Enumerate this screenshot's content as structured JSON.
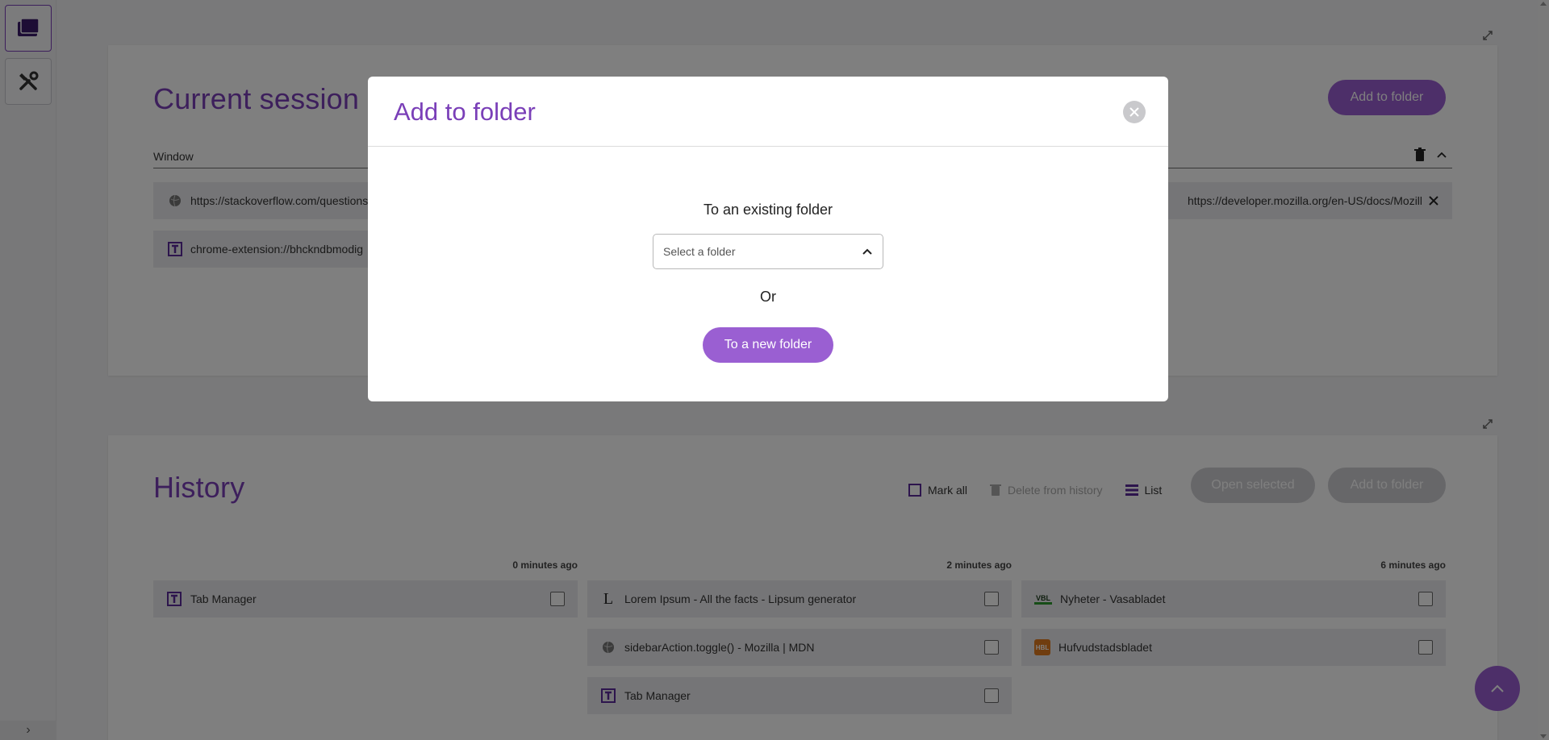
{
  "sidebar": {
    "items": [
      {
        "icon": "folders-icon"
      },
      {
        "icon": "tools-icon"
      }
    ],
    "expand_label": "›"
  },
  "session": {
    "title": "Current session",
    "add_to_folder": "Add to folder",
    "window_label": "Window",
    "tabs": [
      {
        "url": "https://stackoverflow.com/questions",
        "icon": "globe-icon"
      },
      {
        "url": "https://developer.mozilla.org/en-US/docs/Mozilla",
        "icon": "globe-icon"
      },
      {
        "url": "chrome-extension://bhckndbmodig",
        "icon": "tab-manager-icon"
      }
    ]
  },
  "history": {
    "title": "History",
    "mark_all": "Mark all",
    "delete_from_history": "Delete from history",
    "list": "List",
    "open_selected": "Open selected",
    "add_to_folder": "Add to folder",
    "groups": [
      {
        "time": "0 minutes ago",
        "items": [
          {
            "title": "Tab Manager",
            "icon": "tab-manager-icon"
          }
        ]
      },
      {
        "time": "2 minutes ago",
        "items": [
          {
            "title": "Lorem Ipsum - All the facts - Lipsum generator",
            "icon": "lipsum-icon"
          },
          {
            "title": "sidebarAction.toggle() - Mozilla | MDN",
            "icon": "globe-icon"
          },
          {
            "title": "Tab Manager",
            "icon": "tab-manager-icon"
          }
        ]
      },
      {
        "time": "6 minutes ago",
        "items": [
          {
            "title": "Nyheter - Vasabladet",
            "icon": "vbl-icon"
          },
          {
            "title": "Hufvudstadsbladet",
            "icon": "hbl-icon"
          }
        ]
      }
    ]
  },
  "modal": {
    "title": "Add to folder",
    "existing_label": "To an existing folder",
    "select_placeholder": "Select a folder",
    "or_label": "Or",
    "new_folder_button": "To a new folder"
  },
  "colors": {
    "accent": "#7a3fb8",
    "button": "#9a5fd2"
  }
}
